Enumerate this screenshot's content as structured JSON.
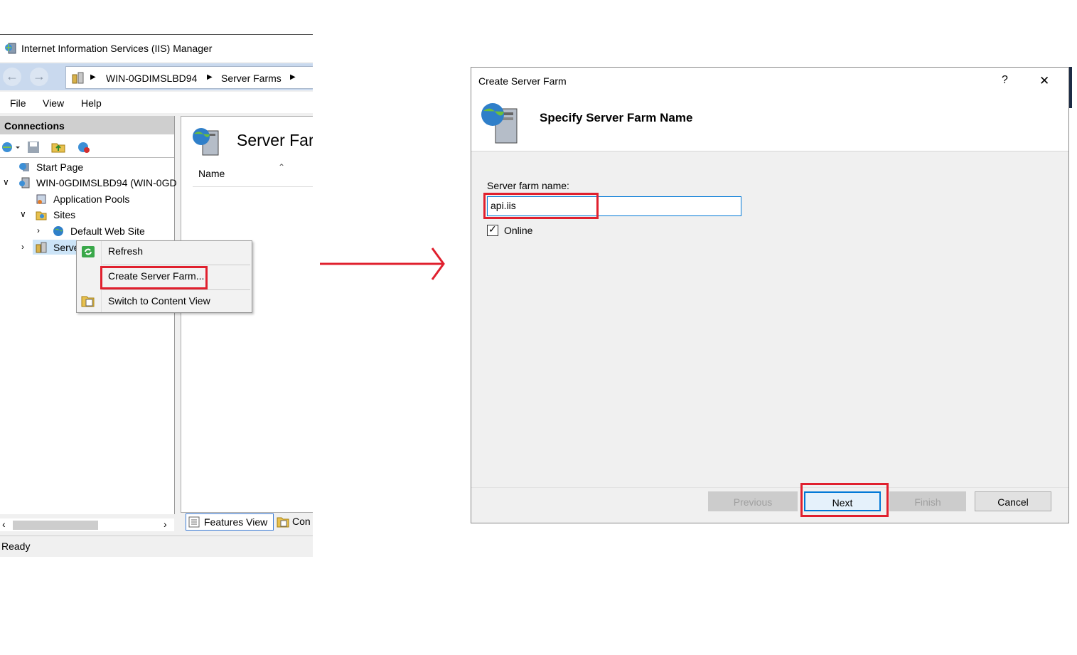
{
  "iis": {
    "title": "Internet Information Services (IIS) Manager",
    "breadcrumb": [
      "WIN-0GDIMSLBD94",
      "Server Farms"
    ],
    "menu": [
      "File",
      "View",
      "Help"
    ],
    "connections_header": "Connections",
    "tree": {
      "start_page": "Start Page",
      "server": "WIN-0GDIMSLBD94 (WIN-0GD",
      "app_pools": "Application Pools",
      "sites": "Sites",
      "default_site": "Default Web Site",
      "server_farms_truncated": "Serve"
    },
    "content_title": "Server Farr",
    "column_name": "Name",
    "bottom_tabs": {
      "features": "Features View",
      "content": "Con"
    },
    "status": "Ready",
    "context_menu": [
      "Refresh",
      "Create Server Farm...",
      "Switch to Content View"
    ]
  },
  "dialog": {
    "title": "Create Server Farm",
    "help": "?",
    "close": "✕",
    "heading": "Specify Server Farm Name",
    "field_label": "Server farm name:",
    "field_value": "api.iis",
    "online_label": "Online",
    "online_checked": true,
    "buttons": {
      "previous": "Previous",
      "next": "Next",
      "finish": "Finish",
      "cancel": "Cancel"
    }
  },
  "colors": {
    "highlight": "#e0202e",
    "accent": "#0078d7"
  }
}
